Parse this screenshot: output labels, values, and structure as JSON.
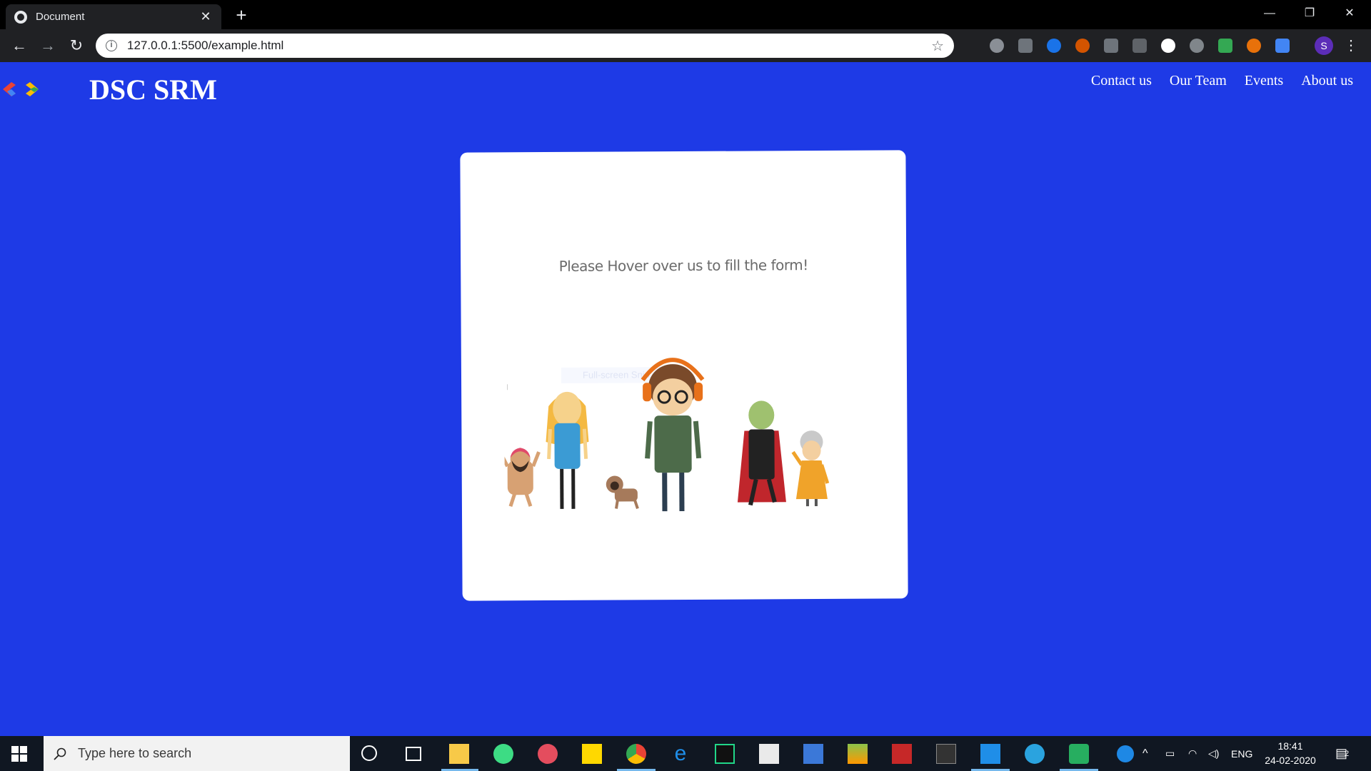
{
  "browser": {
    "tab_title": "Document",
    "tab_close": "✕",
    "new_tab": "+",
    "url": "127.0.0.1:5500/example.html",
    "profile_initial": "S",
    "window_controls": {
      "minimize": "—",
      "restore": "❐",
      "close": "✕"
    }
  },
  "site": {
    "brand": "DSC SRM",
    "nav": [
      "Contact us",
      "Our Team",
      "Events",
      "About us"
    ],
    "card": {
      "prompt": "Please Hover over us to fill the form!",
      "ghost_text": "Full-screen Snip"
    }
  },
  "taskbar": {
    "search_placeholder": "Type here to search",
    "language": "ENG",
    "time": "18:41",
    "date": "24-02-2020",
    "notifications": "2"
  },
  "colors": {
    "page_background": "#1e3ae6",
    "chrome_dark": "#202124",
    "taskbar": "#101722"
  }
}
